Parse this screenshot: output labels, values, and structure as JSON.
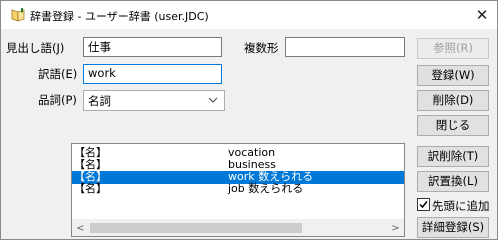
{
  "window": {
    "title": "辞書登録 - ユーザー辞書 (user.JDC)",
    "close_glyph": "✕"
  },
  "form": {
    "midashi_label": "見出し語(J)",
    "midashi_value": "仕事",
    "fukusu_label": "複数形",
    "fukusu_value": "",
    "yakugo_label": "訳語(E)",
    "yakugo_value": "work",
    "hinshi_label": "品詞(P)",
    "hinshi_value": "名詞"
  },
  "buttons": {
    "sansho": "参照(R)",
    "toroku": "登録(W)",
    "sakujo": "削除(D)",
    "tojiru": "閉じる",
    "yaku_sakujo": "訳削除(T)",
    "yaku_chikan": "訳置換(L)",
    "shosai_toroku": "詳細登録(S)"
  },
  "checkbox": {
    "sento_label": "先頭に追加",
    "checked": true
  },
  "list": {
    "rows": [
      {
        "pos": "【名】",
        "text": "vocation",
        "selected": false
      },
      {
        "pos": "【名】",
        "text": "business",
        "selected": false
      },
      {
        "pos": "【名】",
        "text": "work 数えられる",
        "selected": true
      },
      {
        "pos": "【名】",
        "text": "job 数えられる",
        "selected": false
      }
    ],
    "scroll_left": "<",
    "scroll_right": ">"
  }
}
